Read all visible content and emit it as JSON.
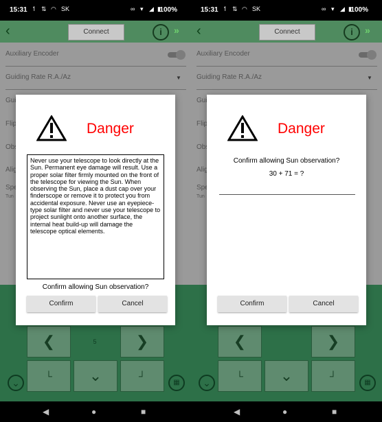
{
  "status": {
    "time": "15:31",
    "carrier": "SK",
    "battery": "100%"
  },
  "toolbar": {
    "connect": "Connect"
  },
  "settings": {
    "aux": "Auxiliary Encoder",
    "guiding": "Guiding Rate R.A./Az",
    "gui_short": "Gui",
    "flip_short": "Flip",
    "obs_short": "Obs",
    "align_short": "Alig",
    "speed_short": "Spe",
    "tune_short": "Tun"
  },
  "control": {
    "speed_value": "5"
  },
  "dialog": {
    "title": "Danger",
    "warning_text": "Never use your telescope to look directly at the Sun. Permanent eye damage will result. Use a proper solar filter firmly mounted on the front of the telescope for viewing the Sun. When observing the Sun, place a dust cap over your finderscope or remove it to protect you from accidental exposure. Never use an eyepiece-type solar filter and never use your telescope to project sunlight onto another surface, the internal heat build-up will damage the telescope optical elements.",
    "question": "Confirm allowing Sun observation?",
    "math": "30 + 71 = ?",
    "confirm": "Confirm",
    "cancel": "Cancel"
  },
  "icons": {
    "back": "back-arrow-icon",
    "info": "info-icon",
    "warning": "warning-icon",
    "expand": "expand-circle-icon",
    "keypad": "keypad-icon"
  }
}
